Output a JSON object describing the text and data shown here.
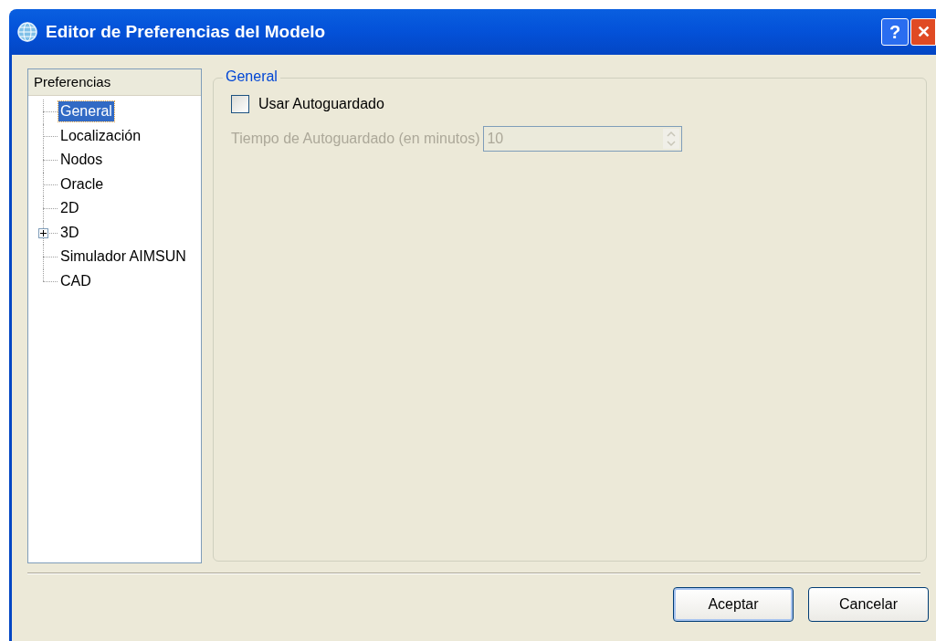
{
  "window": {
    "title": "Editor de Preferencias del Modelo",
    "help_button": "?",
    "close_button": "✕"
  },
  "tree": {
    "header": "Preferencias",
    "items": [
      {
        "label": "General",
        "kind": "leaf",
        "selected": true
      },
      {
        "label": "Localización",
        "kind": "leaf",
        "selected": false
      },
      {
        "label": "Nodos",
        "kind": "leaf",
        "selected": false
      },
      {
        "label": "Oracle",
        "kind": "leaf",
        "selected": false
      },
      {
        "label": "2D",
        "kind": "leaf",
        "selected": false
      },
      {
        "label": "3D",
        "kind": "branch",
        "expanded": false,
        "selected": false
      },
      {
        "label": "Simulador AIMSUN",
        "kind": "leaf",
        "selected": false
      },
      {
        "label": "CAD",
        "kind": "leaf",
        "selected": false
      }
    ]
  },
  "group": {
    "title": "General",
    "autosave": {
      "label": "Usar Autoguardado",
      "checked": false
    },
    "interval": {
      "label": "Tiempo de Autoguardado (en minutos)",
      "value": "10",
      "disabled": true
    }
  },
  "buttons": [
    {
      "label": "Aceptar",
      "default": true
    },
    {
      "label": "Cancelar",
      "default": false
    }
  ]
}
